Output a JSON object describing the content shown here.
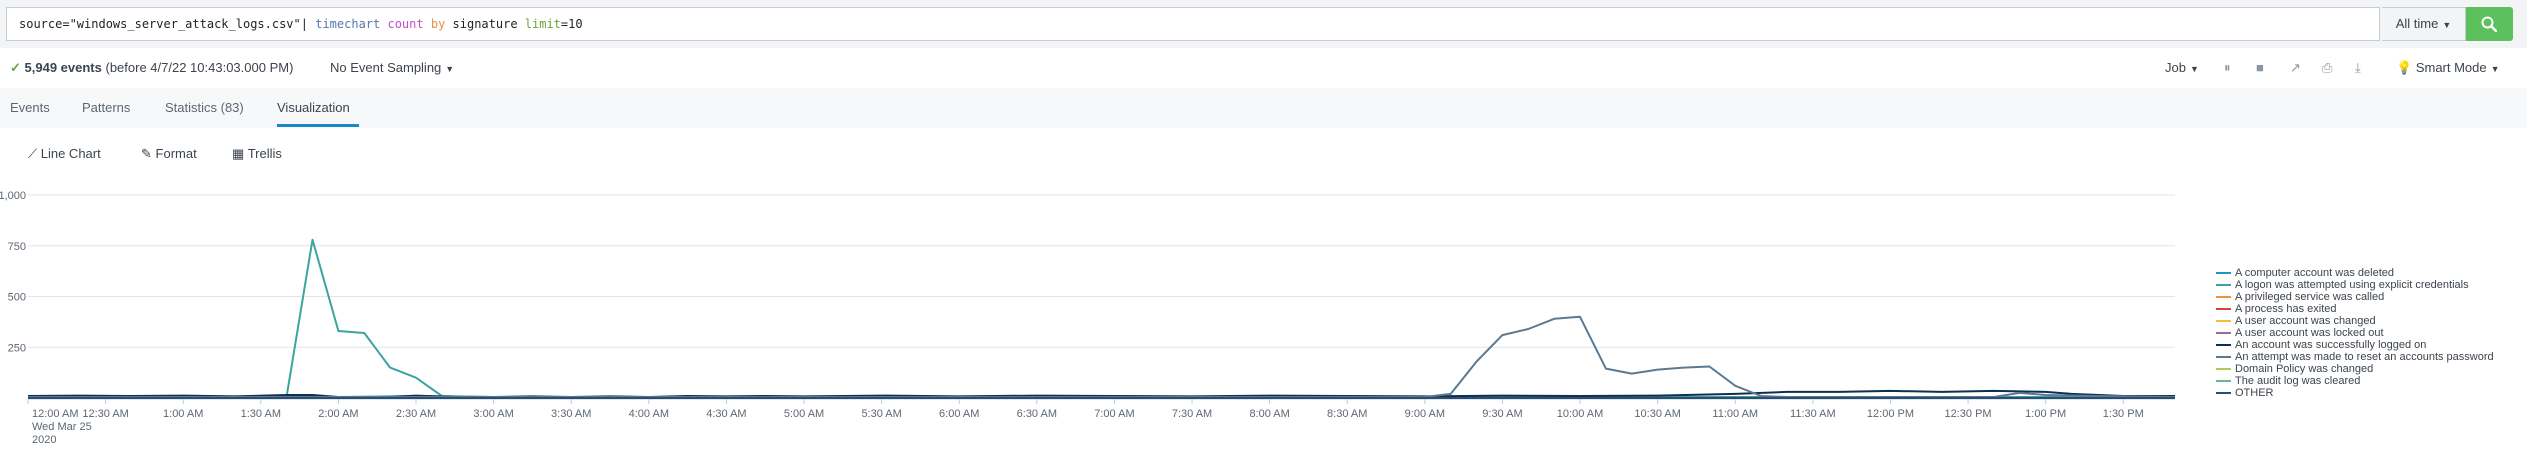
{
  "search": {
    "query_parts": [
      {
        "text": "source=\"windows_server_attack_logs.csv\"| ",
        "cls": "tk-str"
      },
      {
        "text": "timechart",
        "cls": "tk-cmd"
      },
      {
        "text": " ",
        "cls": "tk-str"
      },
      {
        "text": "count",
        "cls": "tk-fn"
      },
      {
        "text": " ",
        "cls": "tk-str"
      },
      {
        "text": "by",
        "cls": "tk-kw"
      },
      {
        "text": " signature ",
        "cls": "tk-str"
      },
      {
        "text": "limit",
        "cls": "tk-arg"
      },
      {
        "text": "=10",
        "cls": "tk-str"
      }
    ],
    "time_range": "All time",
    "search_icon": "magnifier-icon"
  },
  "status": {
    "check": "✓",
    "events": "5,949 events",
    "before": "(before 4/7/22 10:43:03.000 PM)",
    "sampling": "No Event Sampling",
    "job": "Job",
    "mode": "Smart Mode"
  },
  "tabs": [
    {
      "label": "Events"
    },
    {
      "label": "Patterns"
    },
    {
      "label": "Statistics (83)"
    },
    {
      "label": "Visualization"
    }
  ],
  "viz_toolbar": {
    "line_chart": "Line Chart",
    "format": "Format",
    "trellis": "Trellis"
  },
  "colors": {
    "accent_green": "#5cc05c",
    "tab_underline": "#1a87c6"
  },
  "chart_data": {
    "type": "line",
    "title": "",
    "xlabel": "",
    "ylabel": "",
    "ylim": [
      0,
      1000
    ],
    "y_ticks": [
      "1,000",
      "750",
      "500",
      "250"
    ],
    "x_ticks": [
      "12:00 AM",
      "12:30 AM",
      "1:00 AM",
      "1:30 AM",
      "2:00 AM",
      "2:30 AM",
      "3:00 AM",
      "3:30 AM",
      "4:00 AM",
      "4:30 AM",
      "5:00 AM",
      "5:30 AM",
      "6:00 AM",
      "6:30 AM",
      "7:00 AM",
      "7:30 AM",
      "8:00 AM",
      "8:30 AM",
      "9:00 AM",
      "9:30 AM",
      "10:00 AM",
      "10:30 AM",
      "11:00 AM",
      "11:30 AM",
      "12:00 PM",
      "12:30 PM",
      "1:00 PM",
      "1:30 PM"
    ],
    "x_sub": [
      "Wed Mar 25",
      "2020"
    ],
    "x_range_minutes": [
      0,
      830
    ],
    "grid": true,
    "legend_position": "right",
    "series": [
      {
        "name": "A computer account was deleted",
        "color": "#1e93c6",
        "points": [
          [
            0,
            10
          ],
          [
            30,
            10
          ],
          [
            60,
            10
          ],
          [
            90,
            5
          ],
          [
            120,
            5
          ],
          [
            150,
            10
          ],
          [
            180,
            5
          ],
          [
            210,
            5
          ],
          [
            240,
            5
          ],
          [
            270,
            5
          ],
          [
            300,
            5
          ],
          [
            330,
            5
          ],
          [
            360,
            5
          ],
          [
            390,
            5
          ],
          [
            420,
            5
          ],
          [
            450,
            5
          ],
          [
            480,
            5
          ],
          [
            510,
            5
          ],
          [
            540,
            5
          ],
          [
            570,
            5
          ],
          [
            600,
            5
          ],
          [
            630,
            5
          ],
          [
            660,
            5
          ],
          [
            690,
            5
          ],
          [
            720,
            5
          ],
          [
            750,
            5
          ],
          [
            780,
            5
          ],
          [
            810,
            5
          ],
          [
            830,
            5
          ]
        ]
      },
      {
        "name": "A logon was attempted using explicit credentials",
        "color": "#3ca4a0",
        "points": [
          [
            0,
            5
          ],
          [
            30,
            5
          ],
          [
            60,
            5
          ],
          [
            90,
            5
          ],
          [
            100,
            10
          ],
          [
            110,
            780
          ],
          [
            120,
            330
          ],
          [
            130,
            320
          ],
          [
            140,
            150
          ],
          [
            150,
            100
          ],
          [
            160,
            10
          ],
          [
            180,
            5
          ],
          [
            240,
            5
          ],
          [
            300,
            5
          ],
          [
            360,
            5
          ],
          [
            420,
            5
          ],
          [
            480,
            5
          ],
          [
            540,
            5
          ],
          [
            600,
            5
          ],
          [
            660,
            5
          ],
          [
            720,
            5
          ],
          [
            780,
            5
          ],
          [
            830,
            5
          ]
        ]
      },
      {
        "name": "A privileged service was called",
        "color": "#f58f39",
        "points": [
          [
            0,
            0
          ],
          [
            830,
            0
          ]
        ]
      },
      {
        "name": "A process has exited",
        "color": "#d93f3c",
        "points": [
          [
            0,
            0
          ],
          [
            830,
            0
          ]
        ]
      },
      {
        "name": "A user account was changed",
        "color": "#f7bc38",
        "points": [
          [
            0,
            0
          ],
          [
            830,
            0
          ]
        ]
      },
      {
        "name": "A user account was locked out",
        "color": "#956d95",
        "points": [
          [
            0,
            0
          ],
          [
            830,
            0
          ]
        ]
      },
      {
        "name": "An account was successfully logged on",
        "color": "#0e2e54",
        "points": [
          [
            0,
            10
          ],
          [
            20,
            12
          ],
          [
            40,
            10
          ],
          [
            60,
            12
          ],
          [
            80,
            8
          ],
          [
            100,
            15
          ],
          [
            110,
            15
          ],
          [
            120,
            5
          ],
          [
            140,
            5
          ],
          [
            150,
            12
          ],
          [
            165,
            5
          ],
          [
            180,
            5
          ],
          [
            195,
            8
          ],
          [
            210,
            5
          ],
          [
            225,
            8
          ],
          [
            240,
            5
          ],
          [
            255,
            10
          ],
          [
            270,
            8
          ],
          [
            285,
            10
          ],
          [
            300,
            8
          ],
          [
            330,
            12
          ],
          [
            360,
            8
          ],
          [
            390,
            12
          ],
          [
            420,
            10
          ],
          [
            450,
            8
          ],
          [
            480,
            12
          ],
          [
            510,
            10
          ],
          [
            540,
            8
          ],
          [
            570,
            12
          ],
          [
            600,
            10
          ],
          [
            630,
            12
          ],
          [
            660,
            20
          ],
          [
            680,
            30
          ],
          [
            700,
            30
          ],
          [
            720,
            35
          ],
          [
            740,
            30
          ],
          [
            760,
            35
          ],
          [
            780,
            30
          ],
          [
            790,
            20
          ],
          [
            810,
            10
          ],
          [
            830,
            10
          ]
        ]
      },
      {
        "name": "An attempt was made to reset an accounts password",
        "color": "#5a7a94",
        "points": [
          [
            0,
            5
          ],
          [
            300,
            5
          ],
          [
            540,
            5
          ],
          [
            550,
            20
          ],
          [
            560,
            180
          ],
          [
            570,
            310
          ],
          [
            580,
            340
          ],
          [
            590,
            390
          ],
          [
            600,
            400
          ],
          [
            610,
            145
          ],
          [
            620,
            120
          ],
          [
            630,
            140
          ],
          [
            640,
            150
          ],
          [
            650,
            155
          ],
          [
            660,
            60
          ],
          [
            670,
            10
          ],
          [
            680,
            5
          ],
          [
            760,
            5
          ],
          [
            770,
            25
          ],
          [
            780,
            15
          ],
          [
            800,
            10
          ],
          [
            830,
            5
          ]
        ]
      },
      {
        "name": "Domain Policy was changed",
        "color": "#b6c75a",
        "points": [
          [
            0,
            0
          ],
          [
            830,
            0
          ]
        ]
      },
      {
        "name": "The audit log was cleared",
        "color": "#62b3b2",
        "points": [
          [
            0,
            0
          ],
          [
            830,
            0
          ]
        ]
      },
      {
        "name": "OTHER",
        "color": "#294e70",
        "points": [
          [
            0,
            0
          ],
          [
            830,
            0
          ]
        ]
      }
    ]
  }
}
